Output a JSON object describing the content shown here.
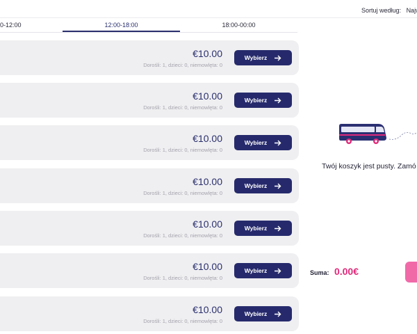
{
  "sort": {
    "label": "Sortuj według:",
    "value": "Najw"
  },
  "tabs": [
    {
      "label": "0-12:00",
      "active": false
    },
    {
      "label": "12:00-18:00",
      "active": true
    },
    {
      "label": "18:00-00:00",
      "active": false
    }
  ],
  "trips": [
    {
      "price": "€10.00",
      "passengers": "Dorośli: 1, dzieci: 0, niemowlęta: 0",
      "button": "Wybierz"
    },
    {
      "price": "€10.00",
      "passengers": "Dorośli: 1, dzieci: 0, niemowlęta: 0",
      "button": "Wybierz"
    },
    {
      "price": "€10.00",
      "passengers": "Dorośli: 1, dzieci: 0, niemowlęta: 0",
      "button": "Wybierz"
    },
    {
      "price": "€10.00",
      "passengers": "Dorośli: 1, dzieci: 0, niemowlęta: 0",
      "button": "Wybierz"
    },
    {
      "price": "€10.00",
      "passengers": "Dorośli: 1, dzieci: 0, niemowlęta: 0",
      "button": "Wybierz"
    },
    {
      "price": "€10.00",
      "passengers": "Dorośli: 1, dzieci: 0, niemowlęta: 0",
      "button": "Wybierz"
    },
    {
      "price": "€10.00",
      "passengers": "Dorośli: 1, dzieci: 0, niemowlęta: 0",
      "button": "Wybierz"
    }
  ],
  "cart": {
    "icon": "bus-icon",
    "empty_text": "Twój koszyk jest pusty. Zamó",
    "sum_label": "Suma:",
    "sum_value": "0.00€"
  },
  "colors": {
    "primary": "#262a6c",
    "accent": "#e0297a",
    "order_button": "#f06aa8",
    "card_bg": "#efeff1"
  }
}
